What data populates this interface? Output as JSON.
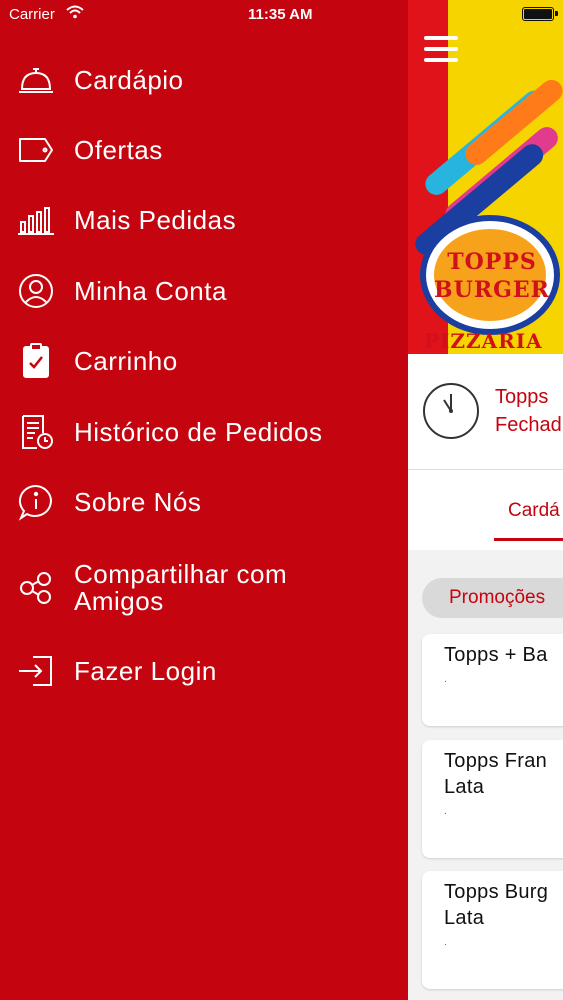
{
  "status_bar": {
    "carrier": "Carrier",
    "time": "11:35 AM",
    "wifi_icon": "wifi-icon",
    "battery_icon": "battery-icon"
  },
  "drawer": {
    "background": "#c4040e",
    "items": [
      {
        "label": "Cardápio",
        "icon": "service-bell-icon"
      },
      {
        "label": "Ofertas",
        "icon": "tag-icon"
      },
      {
        "label": "Mais Pedidas",
        "icon": "bar-chart-icon"
      },
      {
        "label": "Minha Conta",
        "icon": "user-circle-icon"
      },
      {
        "label": "Carrinho",
        "icon": "clipboard-check-icon"
      },
      {
        "label": "Histórico de Pedidos",
        "icon": "receipt-clock-icon"
      },
      {
        "label": "Sobre Nós",
        "icon": "info-bubble-icon"
      },
      {
        "label": "Compartilhar com\nAmigos",
        "icon": "share-nodes-icon"
      },
      {
        "label": "Fazer Login",
        "icon": "login-icon"
      }
    ]
  },
  "main": {
    "menu_icon": "hamburger-icon",
    "logo": {
      "line1": "TOPPS",
      "line2": "BURGER",
      "subtitle": "PIZZARIA"
    },
    "store": {
      "name": "Topps",
      "status": "Fechad"
    },
    "tabs": [
      {
        "label": "Cardá",
        "active": true
      }
    ],
    "category_chip": "Promoções",
    "cards": [
      {
        "title": "Topps + Ba",
        "subtitle": "."
      },
      {
        "title": "Topps Fran\nLata",
        "subtitle": "."
      },
      {
        "title": "Topps Burg\nLata",
        "subtitle": "."
      }
    ]
  },
  "colors": {
    "accent": "#c4040e",
    "banner_yellow": "#f5d400",
    "logo_blue": "#1a3fa0"
  }
}
